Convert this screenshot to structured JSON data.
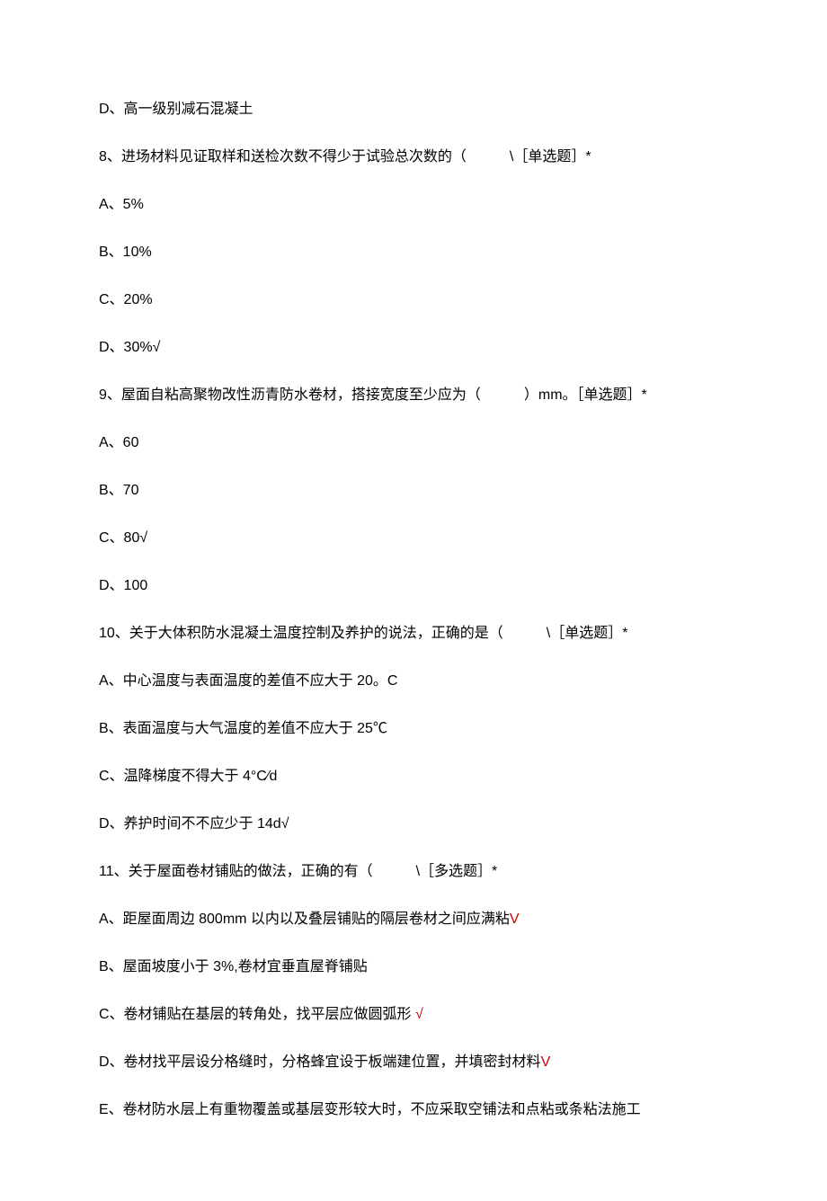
{
  "lines": [
    {
      "text": "D、高一级别减石混凝土"
    },
    {
      "text": "8、进场材料见证取样和送检次数不得少于试验总次数的（　　　\\［单选题］*"
    },
    {
      "text": "A、5%"
    },
    {
      "text": "B、10%"
    },
    {
      "text": "C、20%"
    },
    {
      "text": "D、30%√"
    },
    {
      "text": "9、屋面自粘高聚物改性沥青防水卷材，搭接宽度至少应为（　　　）mm。［单选题］*"
    },
    {
      "text": "A、60"
    },
    {
      "text": "B、70"
    },
    {
      "text": "C、80√"
    },
    {
      "text": "D、100"
    },
    {
      "text": "10、关于大体积防水混凝土温度控制及养护的说法，正确的是（　　　\\［单选题］*"
    },
    {
      "text": "A、中心温度与表面温度的差值不应大于 20。C"
    },
    {
      "text": "B、表面温度与大气温度的差值不应大于 25℃"
    },
    {
      "text": "C、温降梯度不得大于 4°C⁄d"
    },
    {
      "text": "D、养护时间不不应少于 14d√"
    },
    {
      "text": "11、关于屋面卷材铺贴的做法，正确的有（　　　\\［多选题］*"
    },
    {
      "text": "A、距屋面周边 800mm 以内以及叠层铺贴的隔层卷材之间应满粘",
      "mark": "V"
    },
    {
      "text": "B、屋面坡度小于 3%,卷材宜垂直屋脊铺贴"
    },
    {
      "text": "C、卷材铺贴在基层的转角处，找平层应做圆弧形 ",
      "mark": "√"
    },
    {
      "text": "D、卷材找平层设分格缝时，分格蜂宜设于板端建位置，并填密封材料",
      "mark": "V"
    },
    {
      "text": "E、卷材防水层上有重物覆盖或基层变形较大时，不应采取空铺法和点粘或条粘法施工"
    }
  ]
}
